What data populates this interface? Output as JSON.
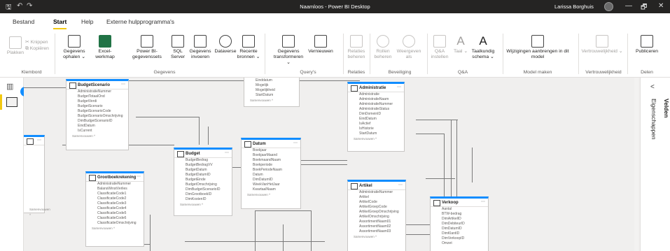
{
  "window": {
    "title": "Naamloos - Power BI Desktop",
    "user": "Larissa Borghuis",
    "quick_access": [
      "save-icon",
      "undo-icon",
      "redo-icon"
    ],
    "controls": [
      "—",
      "🗗",
      "✕"
    ]
  },
  "tabs": [
    "Bestand",
    "Start",
    "Help",
    "Externe hulpprogramma's"
  ],
  "active_tab": "Start",
  "ribbon": {
    "clipboard": {
      "paste": "Plakken",
      "cut": "Knippen",
      "copy": "Kopiëren",
      "group": "Klembord"
    },
    "data": {
      "get": "Gegevens ophalen ⌄",
      "excel": "Excel-werkmap",
      "pbi": "Power BI-gegevenssets",
      "sql": "SQL Server",
      "enter": "Gegevens invoeren",
      "dataverse": "Dataverse",
      "recent": "Recente bronnen ⌄",
      "group": "Gegevens"
    },
    "queries": {
      "transform": "Gegevens transformeren ⌄",
      "refresh": "Vernieuwen",
      "group": "Query's"
    },
    "relations": {
      "manage": "Relaties beheren",
      "group": "Relaties"
    },
    "security": {
      "roles": "Rollen beheren",
      "view_as": "Weergeven als",
      "group": "Beveiliging"
    },
    "qa": {
      "setup": "Q&A instellen",
      "language": "Taal ⌄",
      "schema": "Taalkundig schema ⌄",
      "group": "Q&A"
    },
    "model": {
      "changes": "Wijzigingen aanbrengen in dit model",
      "group": "Model maken"
    },
    "sensitivity": {
      "label": "Vertrouwelijkheid ⌄",
      "group": "Vertrouwelijkheid"
    },
    "share": {
      "publish": "Publiceren",
      "group": "Delen"
    }
  },
  "sidebar": {
    "badge": "1"
  },
  "panels": {
    "fields": "Velden",
    "properties": "Eigenschappen",
    "collapse": "<"
  },
  "tables": {
    "budgetscenario": {
      "name": "BudgetScenario",
      "fields": [
        "AdministratieNummer",
        "BudgetTotaalOnd",
        "BudgetVerdi",
        "BudgetScenario",
        "BudgetScenarioCode",
        "BudgetScenarioOmschrijving",
        "DimBudgetScenarioID",
        "EindDatum",
        "IsCurrent"
      ],
      "more": "Samenvouwen ^"
    },
    "datum_top": {
      "name": "",
      "fields": [
        "Einddatum",
        "Mogelijk",
        "Mogelijkheid",
        "StartDatum"
      ],
      "more": "Samenvouwen ^"
    },
    "administratie": {
      "name": "Administratie",
      "fields": [
        "Administratie",
        "AdministratieNaam",
        "AdministratieNummer",
        "AdministratieStatus",
        "DimDomeinID",
        "EindDatum",
        "IsActief",
        "IsHistorie",
        "StartDatum"
      ],
      "more": "Samenvouwen ^"
    },
    "left": {
      "name": "",
      "fields": [],
      "more": "Samenvouwen ^"
    },
    "budget": {
      "name": "Budget",
      "fields": [
        "BudgetBedrag",
        "BudgetBedragVV",
        "BudgetDatum",
        "BudgetDatumID",
        "BudgetEinde",
        "BudgetOmschrijving",
        "DimBudgetScenarioID",
        "DimGrootboekID",
        "DimKostenID"
      ],
      "more": "Samenvouwen ^"
    },
    "datum": {
      "name": "Datum",
      "fields": [
        "Boekjaar",
        "BoekjaarMaand",
        "BoekmaandNaam",
        "Boekperiode",
        "BoekPeriodeNaam",
        "Datum",
        "DimDatumID",
        "WeekVanHetJaar",
        "KwartaalNaam"
      ],
      "more": "Samenvouwen ^"
    },
    "grootboek": {
      "name": "Grootboekrekening",
      "fields": [
        "AdministratieNummer",
        "BalansWinstVerlies",
        "ClassificatieCode1",
        "ClassificatieCode2",
        "ClassificatieCode3",
        "ClassificatieCode4",
        "ClassificatieCode5",
        "ClassificatieCode6",
        "ClassificatieOmschrijving"
      ],
      "more": "Samenvouwen ^"
    },
    "artikel": {
      "name": "Artikel",
      "fields": [
        "AdministratieNummer",
        "Artikel",
        "ArtikelCode",
        "ArtikelGroepCode",
        "ArtikelGroepOmschrijving",
        "ArtikelOmschrijving",
        "AssortimentNaam01",
        "AssortimentNaam02",
        "AssortimentNaam03"
      ],
      "more": "Samenvouwen ^"
    },
    "verkoop": {
      "name": "Verkoop",
      "fields": [
        "Aantal",
        "BTW-bedrag",
        "DimArtikelID",
        "DimDebiteurID",
        "DimDatumID",
        "DimKlantID",
        "DimVerkoopID",
        "Omzet"
      ],
      "more": "Samenvouwen ^"
    }
  }
}
